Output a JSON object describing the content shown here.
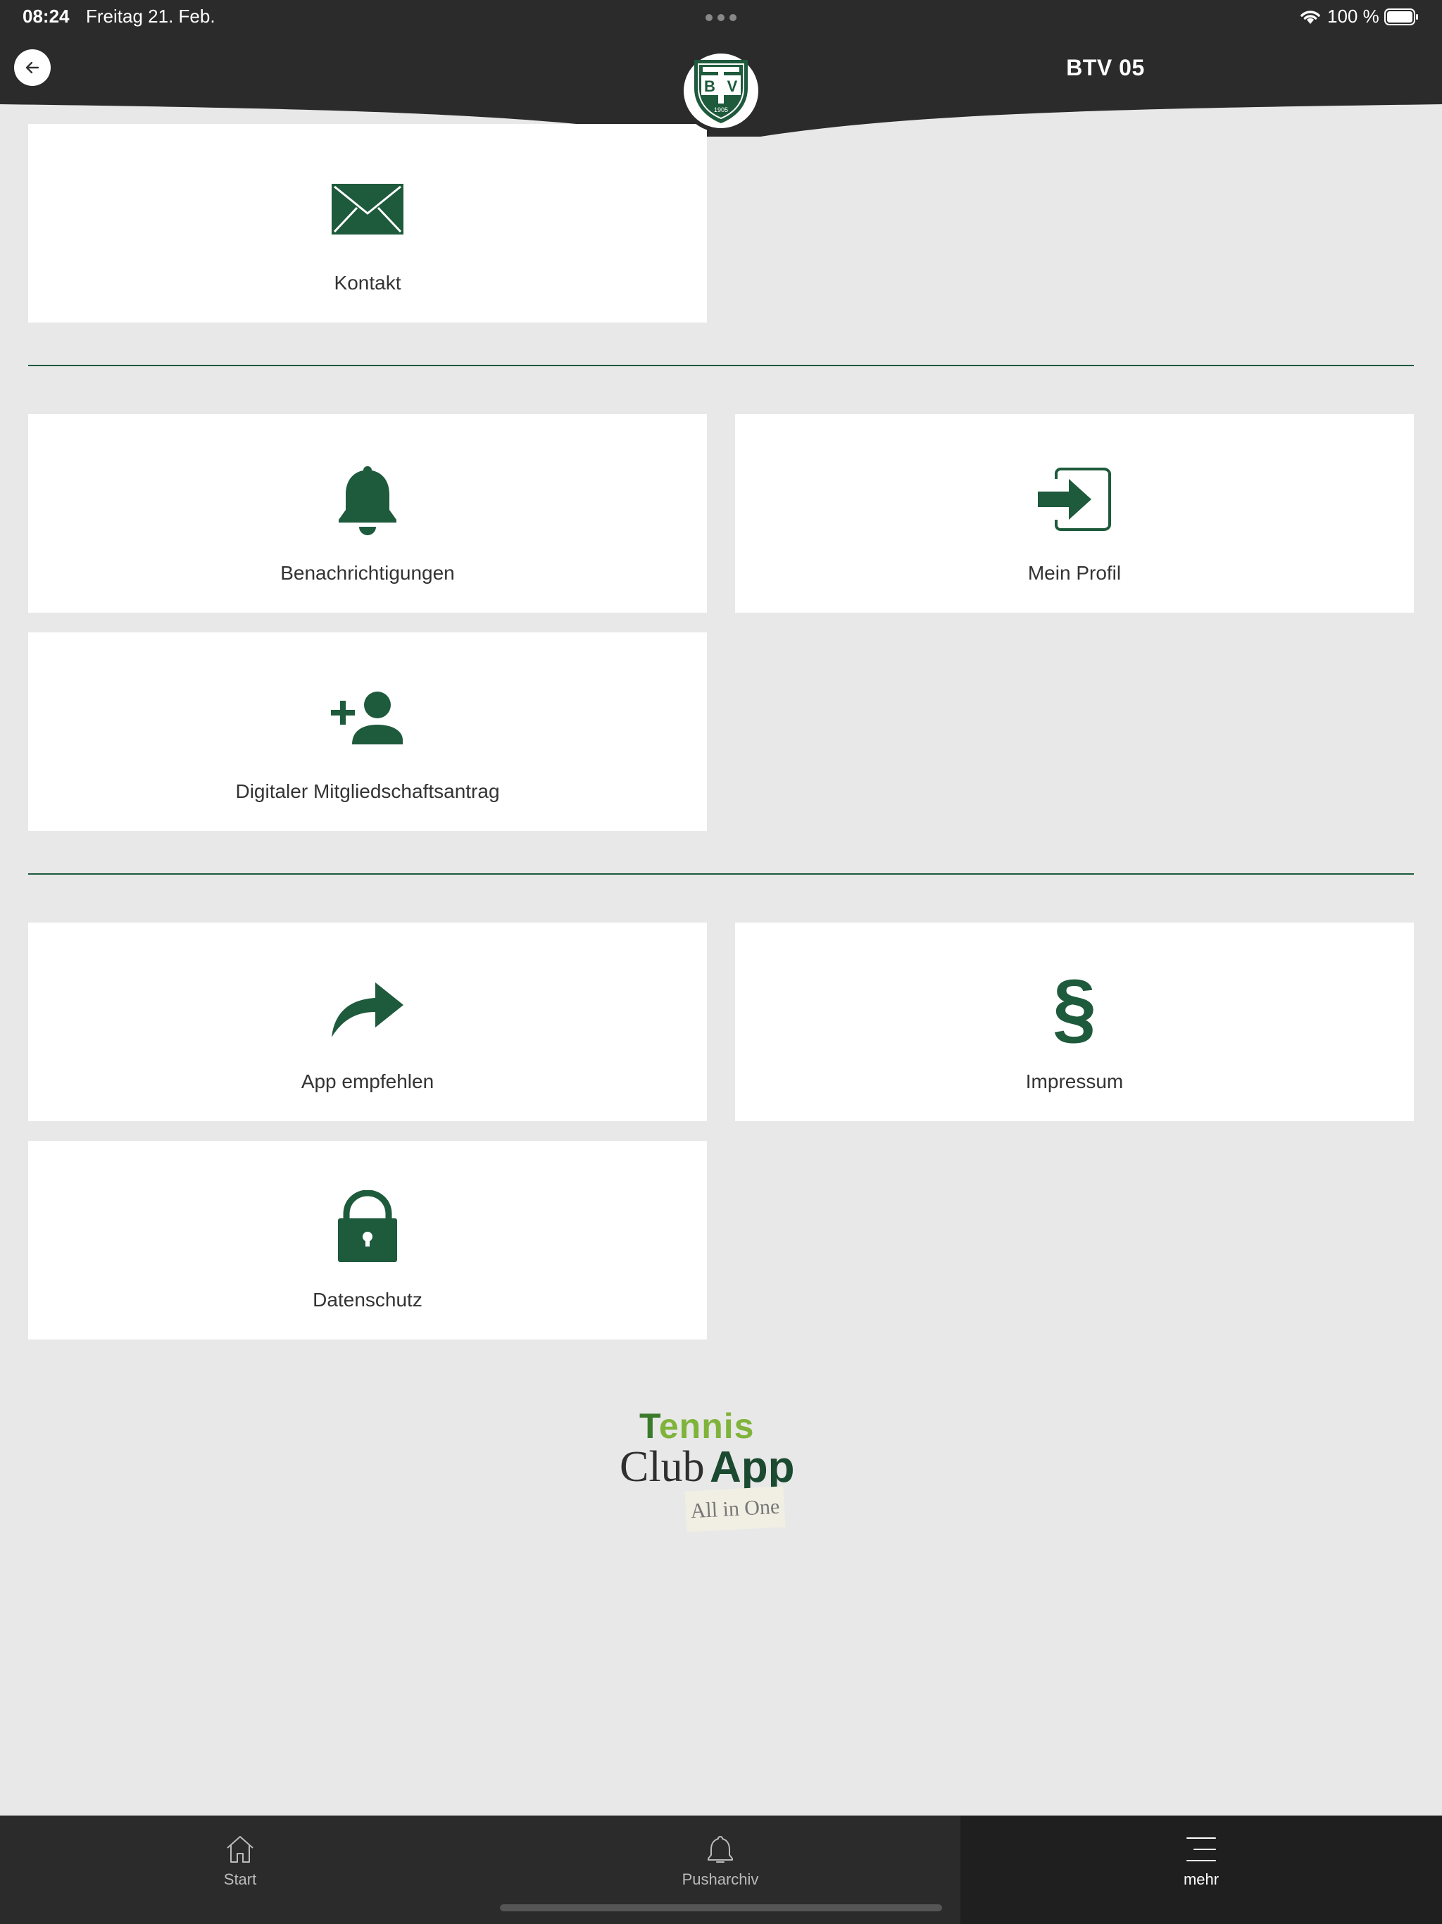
{
  "status_bar": {
    "time": "08:24",
    "date": "Freitag 21. Feb.",
    "battery_text": "100 %"
  },
  "header": {
    "title": "BTV 05",
    "logo_letters": "BTV",
    "logo_year": "1905"
  },
  "colors": {
    "brand_green": "#1e5a3c",
    "dark_bar": "#2b2b2b",
    "background": "#e8e8e8"
  },
  "tiles": {
    "kontakt": {
      "label": "Kontakt",
      "icon": "envelope-icon"
    },
    "benachrichtigungen": {
      "label": "Benachrichtigungen",
      "icon": "bell-icon"
    },
    "mein_profil": {
      "label": "Mein Profil",
      "icon": "login-icon"
    },
    "mitgliedschaft": {
      "label": "Digitaler Mitgliedschaftsantrag",
      "icon": "add-person-icon"
    },
    "app_empfehlen": {
      "label": "App empfehlen",
      "icon": "share-arrow-icon"
    },
    "impressum": {
      "label": "Impressum",
      "icon": "paragraph-icon",
      "glyph": "§"
    },
    "datenschutz": {
      "label": "Datenschutz",
      "icon": "lock-icon"
    }
  },
  "brand": {
    "tennis_first": "T",
    "tennis_rest": "ennis",
    "club": "Club",
    "app": "App",
    "tagline": "All in One"
  },
  "tabbar": {
    "start": {
      "label": "Start",
      "icon": "home-icon"
    },
    "pusharchiv": {
      "label": "Pusharchiv",
      "icon": "bell-outline-icon"
    },
    "mehr": {
      "label": "mehr",
      "icon": "menu-icon"
    }
  }
}
